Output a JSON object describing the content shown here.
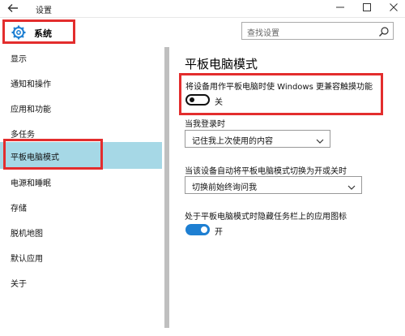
{
  "window": {
    "title": "设置",
    "back_icon": "back-arrow-icon",
    "minimize_icon": "minimize-icon",
    "maximize_icon": "maximize-icon",
    "close_icon": "close-icon"
  },
  "header": {
    "section_icon": "gear-icon",
    "section_label": "系统",
    "search_placeholder": "查找设置",
    "search_icon": "search-icon"
  },
  "sidebar": {
    "items": [
      {
        "label": "显示"
      },
      {
        "label": "通知和操作"
      },
      {
        "label": "应用和功能"
      },
      {
        "label": "多任务"
      },
      {
        "label": "平板电脑模式",
        "active": true
      },
      {
        "label": "电源和睡眠"
      },
      {
        "label": "存储"
      },
      {
        "label": "脱机地图"
      },
      {
        "label": "默认应用"
      },
      {
        "label": "关于"
      }
    ]
  },
  "main": {
    "title": "平板电脑模式",
    "touch_option": {
      "label": "将设备用作平板电脑时使 Windows 更兼容触摸功能",
      "state": "关",
      "on": false
    },
    "signin": {
      "label": "当我登录时",
      "value": "记住我上次使用的内容"
    },
    "auto_switch": {
      "label": "当该设备自动将平板电脑模式切换为开或关时",
      "value": "切换前始终询问我"
    },
    "hide_icons": {
      "label": "处于平板电脑模式时隐藏任务栏上的应用图标",
      "state": "开",
      "on": true
    }
  },
  "colors": {
    "highlight_box": "#e32d2d",
    "active_nav": "#a6d8e6",
    "toggle_on": "#1e7fd2",
    "gear_icon": "#1e7fd2"
  }
}
